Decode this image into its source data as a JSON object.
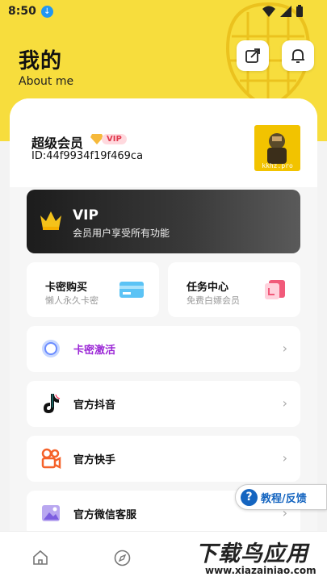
{
  "status_bar": {
    "time": "8:50",
    "download_icon": "download-icon"
  },
  "header": {
    "title": "我的",
    "subtitle": "About me",
    "share_icon": "share-icon",
    "bell_icon": "bell-icon"
  },
  "user": {
    "name": "超级会员",
    "badge": "VIP",
    "id_text": "ID:44f9934f19f469ca",
    "avatar_text": "kkhz.pro"
  },
  "vip_card": {
    "title": "VIP",
    "description": "会员用户享受所有功能"
  },
  "tiles": [
    {
      "title": "卡密购买",
      "description": "懒人永久卡密",
      "icon": "card-icon"
    },
    {
      "title": "任务中心",
      "description": "免费白嫖会员",
      "icon": "task-icon"
    }
  ],
  "rows": [
    {
      "label": "卡密激活",
      "icon": "activate-icon",
      "color": "#9b27d6"
    },
    {
      "label": "官方抖音",
      "icon": "tiktok-icon",
      "color": "#111111"
    },
    {
      "label": "官方快手",
      "icon": "kuaishou-icon",
      "color": "#111111"
    },
    {
      "label": "官方微信客服",
      "icon": "image-icon",
      "color": "#111111"
    }
  ],
  "feedback": {
    "label": "教程/反馈"
  },
  "bottom_nav": {
    "items": [
      "home-icon",
      "compass-icon"
    ]
  },
  "watermark": {
    "main": "下载鸟应用",
    "url": "www.xiazainiao.com"
  },
  "colors": {
    "accent_yellow": "#f7dd3d",
    "purple": "#9b27d6",
    "link_blue": "#1565c0"
  }
}
